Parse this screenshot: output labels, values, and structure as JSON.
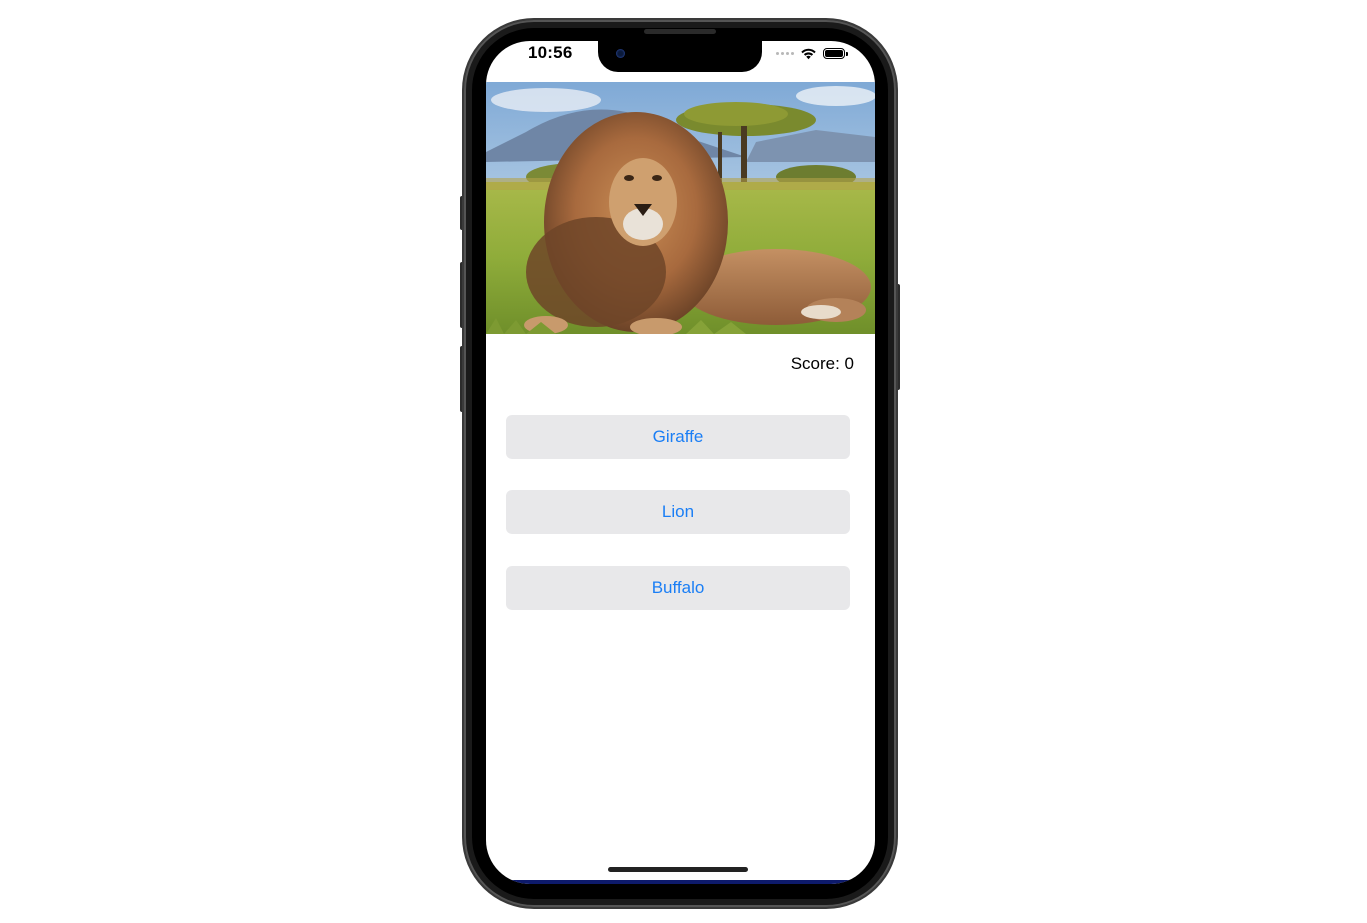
{
  "status_bar": {
    "time": "10:56",
    "icons": [
      "cellular-signal-icon",
      "wifi-icon",
      "battery-icon"
    ],
    "battery_level": 1.0
  },
  "hero": {
    "image": "lion-photo",
    "description_icon": "lion-photo"
  },
  "score": {
    "label": "Score: 0"
  },
  "answers": [
    {
      "label": "Giraffe"
    },
    {
      "label": "Lion"
    },
    {
      "label": "Buffalo"
    }
  ],
  "colors": {
    "button_text": "#1a7ef5",
    "button_background": "#e8e8ea",
    "screen_background": "#ffffff"
  }
}
